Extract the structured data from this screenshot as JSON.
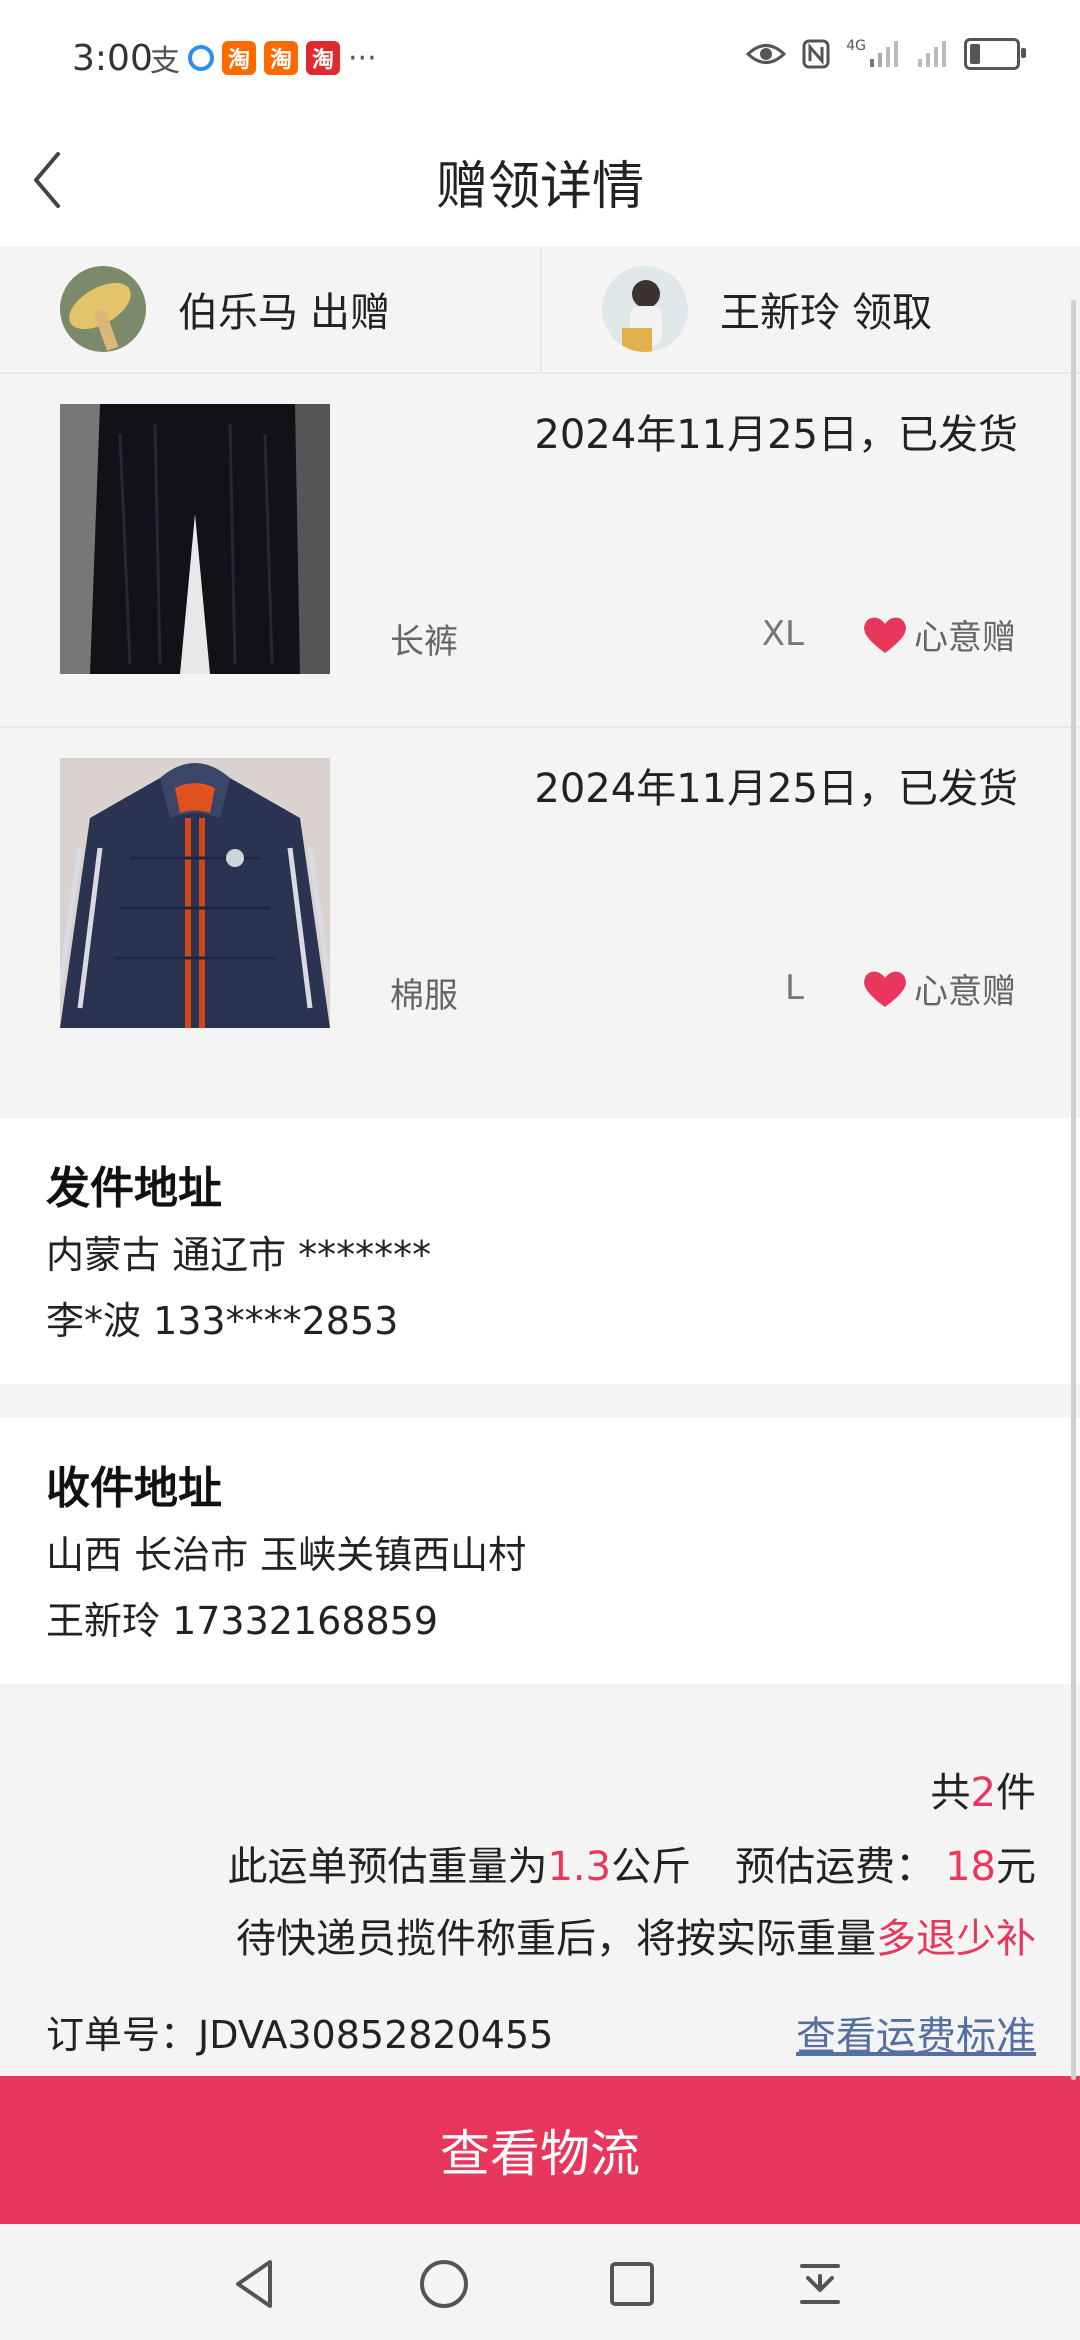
{
  "status_bar": {
    "time": "3:00",
    "apps": [
      "支",
      "淘",
      "淘",
      "淘"
    ],
    "more": "···",
    "network": "4G"
  },
  "header": {
    "title": "赠领详情"
  },
  "parties": {
    "giver": {
      "name": "伯乐马",
      "role": "出赠"
    },
    "receiver": {
      "name": "王新玲",
      "role": "领取"
    }
  },
  "items": [
    {
      "date_status": "2024年11月25日，已发货",
      "name": "长裤",
      "size": "XL",
      "tag": "心意赠"
    },
    {
      "date_status": "2024年11月25日，已发货",
      "name": "棉服",
      "size": "L",
      "tag": "心意赠"
    }
  ],
  "sender_address": {
    "heading": "发件地址",
    "region": "内蒙古 通辽市 *******",
    "contact": "李*波 133****2853"
  },
  "receiver_address": {
    "heading": "收件地址",
    "region": "山西 长治市 玉峡关镇西山村",
    "contact": "王新玲 17332168859"
  },
  "summary": {
    "count_prefix": "共",
    "count": "2",
    "count_suffix": "件",
    "weight_prefix": "此运单预估重量为",
    "weight": "1.3",
    "weight_unit": "公斤",
    "fee_prefix": "预估运费：",
    "fee": "18",
    "fee_unit": "元",
    "note_prefix": "待快递员揽件称重后，将按实际重量",
    "note_highlight": "多退少补",
    "order_label": "订单号：",
    "order_number": "JDVA30852820455",
    "fee_standard_link": "查看运费标准"
  },
  "buttons": {
    "logistics": "查看物流"
  },
  "colors": {
    "accent": "#e8365d",
    "link": "#5570a0",
    "background": "#f4f4f4"
  }
}
